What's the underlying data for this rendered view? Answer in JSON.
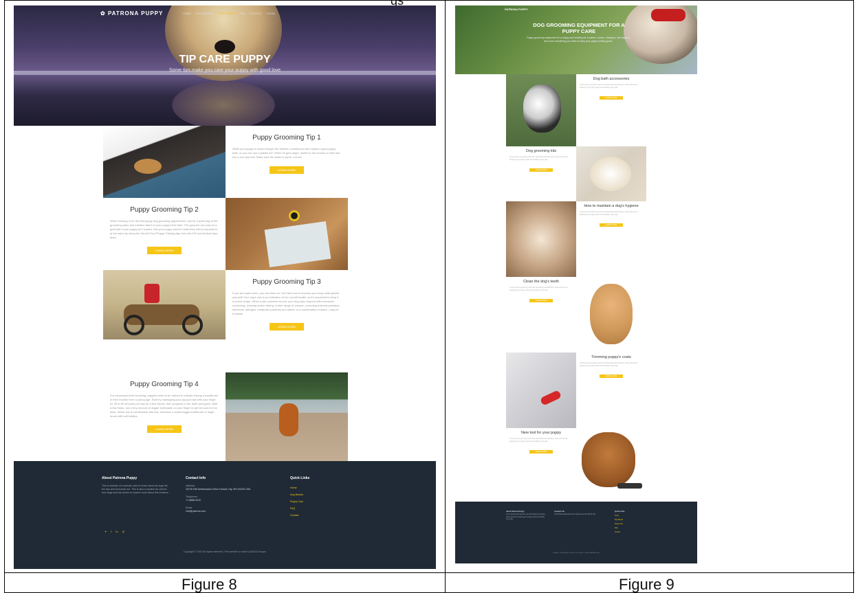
{
  "fig8": {
    "logo": "PATRONA PUPPY",
    "nav": [
      "HOME",
      "DOG BREEDS",
      "PUPPY CARE",
      "FAQ",
      "CONTACT",
      "LOGIN"
    ],
    "hero_title": "TIP CARE PUPPY",
    "hero_subtitle": "Some tips make you care your puppy with good love",
    "tips": [
      {
        "title": "Puppy Grooming Tip 1",
        "text": "While your puppy is small enough, the kitchen or bathroom sink makes a good puppy bath, or you can use a plastic tub. When he gets larger, switch to the shower or bath and use a non-slip mat. Make sure the water is warm, not hot.",
        "button": "LEARN MORE"
      },
      {
        "title": "Puppy Grooming Tip 2",
        "text": "When booking in for the first puppy dog grooming appointment, ask for a quiet day at the grooming salon and mention that it is your puppy's first time. The groomer can only do a good job if your puppy isn't scared. Get your puppy used to noise they will be exposed to at the salon by using the Sound Proof Puppy Training App from the iOS and Android App store.",
        "button": "LEARN MORE"
      },
      {
        "title": "Puppy Grooming Tip 3",
        "text": "If you are super keen, you can learn on YouTube how to express your dog's anal glands yourself! Your dog's skin is an indication of her overall health, so it's important to keep it in prime shape. When a skin problem occurs, your dog may respond with excessive scratching, chewing and/or licking. A wide range of causes—including external parasites, infections, allergies, metabolic problems and stress, or a combination of these—may be to blame.",
        "button": "LEARN MORE"
      },
      {
        "title": "Puppy Grooming Tip 4",
        "text": "For successful teeth brushing, puppies need to be trained to tolerate having a toothbrush in their mouths from a young age. Start by massaging your puppy's lips with your finger for 30 to 60 seconds per day for a few weeks, then progress to her teeth and gums. After a few times, use a tiny amount of doggie toothpaste on your finger to get her used to the taste. When she is comfortable with this, introduce a small doggie toothbrush or finger brush with soft bristles.",
        "button": "LEARN MORE"
      }
    ],
    "footer": {
      "about_title": "About Patrona Puppy",
      "about_text": "This is website of a website used to share about all dogs the fun tips and resources etc. This is also a location for person love dogs and has desire to explore more about this creature.",
      "contact_title": "Contact Info",
      "address_label": "Address:",
      "address": "16740 NW Ambassador Drive Kansas City, MO 64153 USA",
      "phone_label": "Telephone:",
      "phone": "+1 8888-3232",
      "email_label": "Email:",
      "email": "info@patrona.com",
      "links_title": "Quick Links",
      "links": [
        "Home",
        "Dog Breeds",
        "Puppy Care",
        "FAQ",
        "Contact"
      ],
      "social": [
        "twitter-icon",
        "facebook-icon",
        "linkedin-icon",
        "instagram-icon"
      ],
      "copyright": "Copyright © 2022 All rights reserved | This website is made by ANCIA Groups"
    },
    "caption": "Figure 8"
  },
  "fig9": {
    "logo": "PATRONA PUPPY",
    "hero_title": "DOG GROOMING EQUIPMENT FOR A PUPPY CARE",
    "hero_subtitle": "Puppy grooming equipment for a happy and healthy pet: brushes, combs, shampoo, nail clippers and more everything you need to keep your puppy looking good.",
    "sections": [
      {
        "title": "Dog bath accessories",
        "button": "LEARN MORE"
      },
      {
        "title": "Dog grooming kits",
        "button": "LEARN MORE"
      },
      {
        "title": "How to maintain a dog's hygiene",
        "button": "LEARN MORE"
      },
      {
        "title": "Clean the dog's teeth",
        "button": "LEARN MORE"
      },
      {
        "title": "Trimming puppy's coats",
        "button": "LEARN MORE"
      },
      {
        "title": "New tool for your puppy",
        "button": "LEARN MORE"
      }
    ],
    "filler_text": "Lorem ipsum grooming care text describing accessories, tools and tips for keeping your puppy clean and healthy every day.",
    "footer": {
      "about_title": "About Patrona Puppy",
      "contact_title": "Contact Info",
      "links_title": "Quick Links",
      "links": [
        "Home",
        "Dog Breeds",
        "Puppy Care",
        "FAQ",
        "Contact"
      ],
      "copyright": "Copyright © 2022 All rights reserved | This website is made by ANCIA Groups"
    },
    "caption": "Figure 9"
  },
  "doc_top_fragment": "gs"
}
